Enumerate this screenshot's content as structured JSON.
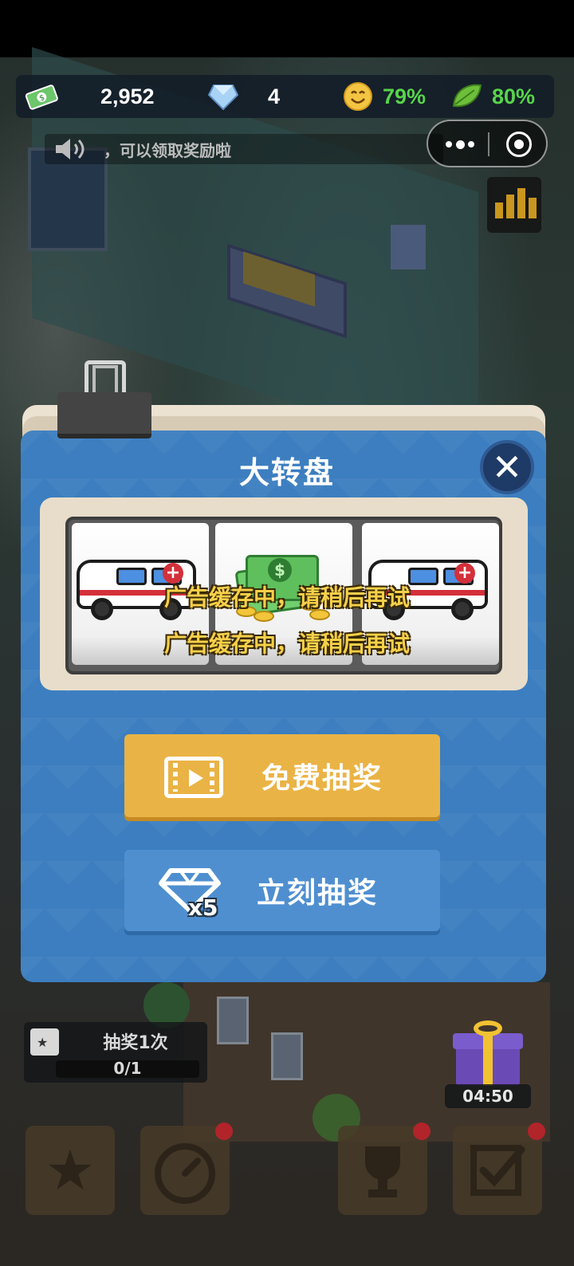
{
  "resources": {
    "money": "2,952",
    "gems": "4",
    "satisfaction": "79%",
    "eco": "80%"
  },
  "notice": {
    "text": "，可以领取奖励啦"
  },
  "dialog": {
    "title": "大转盘",
    "close_label": "✕",
    "reels": [
      "ambulance",
      "money-stack",
      "ambulance"
    ],
    "toasts": [
      "广告缓存中，请稍后再试",
      "广告缓存中，请稍后再试"
    ],
    "free_button_label": "免费抽奖",
    "now_button_label": "立刻抽奖",
    "gem_cost": "x5"
  },
  "task": {
    "label": "抽奖1次",
    "progress": "0/1"
  },
  "gift": {
    "timer": "04:50"
  },
  "dock": {
    "items": [
      "book-icon",
      "speedometer-icon",
      "trophy-icon",
      "checklist-icon"
    ]
  },
  "colors": {
    "panel": "#3c7ec0",
    "free_button": "#eab345",
    "now_button": "#4f8fd0",
    "positive_stat": "#58d44b",
    "toast": "#f7d04a"
  }
}
